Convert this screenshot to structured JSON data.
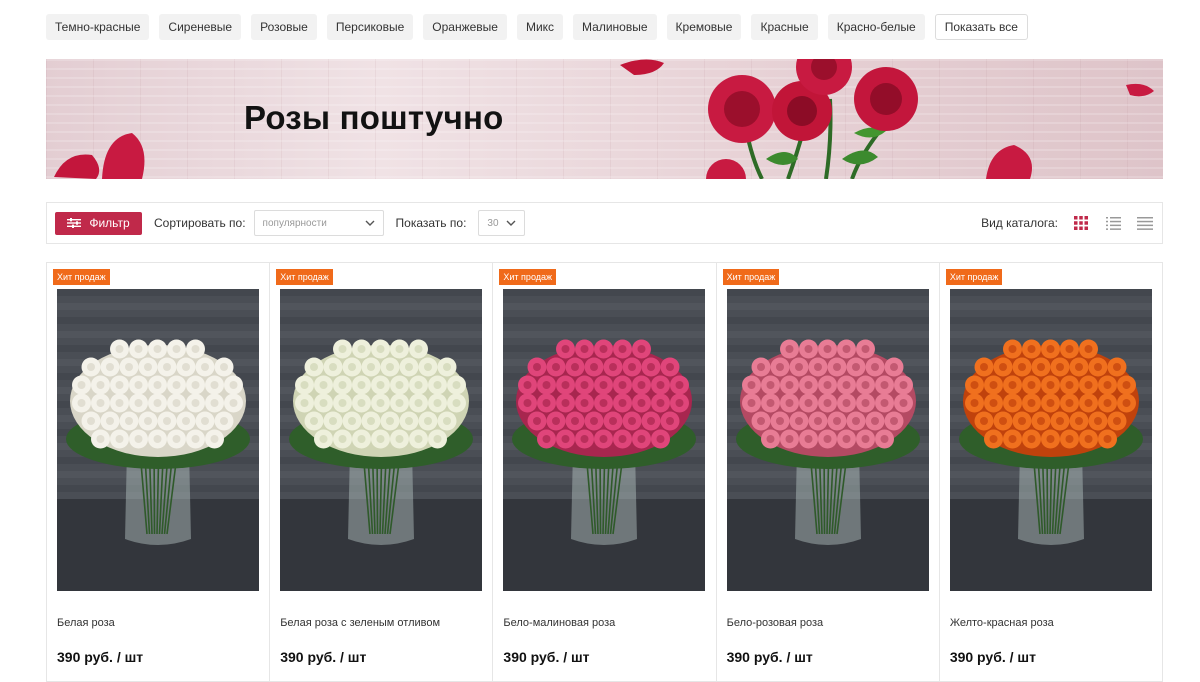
{
  "colors": {
    "accent": "#c0294a",
    "badge": "#f06a1a"
  },
  "chips": [
    "Темно-красные",
    "Сиреневые",
    "Розовые",
    "Персиковые",
    "Оранжевые",
    "Микс",
    "Малиновые",
    "Кремовые",
    "Красные",
    "Красно-белые"
  ],
  "show_all": "Показать все",
  "banner": {
    "title": "Розы поштучно"
  },
  "toolbar": {
    "filter_label": "Фильтр",
    "sort_label": "Сортировать по:",
    "sort_value": "популярности",
    "show_label": "Показать по:",
    "show_value": "30",
    "view_label": "Вид каталога:",
    "view_modes": [
      "grid-icon",
      "list-icon",
      "table-icon"
    ]
  },
  "products": [
    {
      "badge": "Хит продаж",
      "name": "Белая роза",
      "price": "390 руб. / шт",
      "flower_color": "#f4f2ea",
      "flower_shade": "#d9d6c8"
    },
    {
      "badge": "Хит продаж",
      "name": "Белая роза с зеленым отливом",
      "price": "390 руб. / шт",
      "flower_color": "#eef0dc",
      "flower_shade": "#cfd4b4"
    },
    {
      "badge": "Хит продаж",
      "name": "Бело-малиновая роза",
      "price": "390 руб. / шт",
      "flower_color": "#e0457a",
      "flower_shade": "#a8264f"
    },
    {
      "badge": "Хит продаж",
      "name": "Бело-розовая роза",
      "price": "390 руб. / шт",
      "flower_color": "#e87c95",
      "flower_shade": "#b44a63"
    },
    {
      "badge": "Хит продаж",
      "name": "Желто-красная роза",
      "price": "390 руб. / шт",
      "flower_color": "#f0701e",
      "flower_shade": "#c0420c"
    }
  ]
}
